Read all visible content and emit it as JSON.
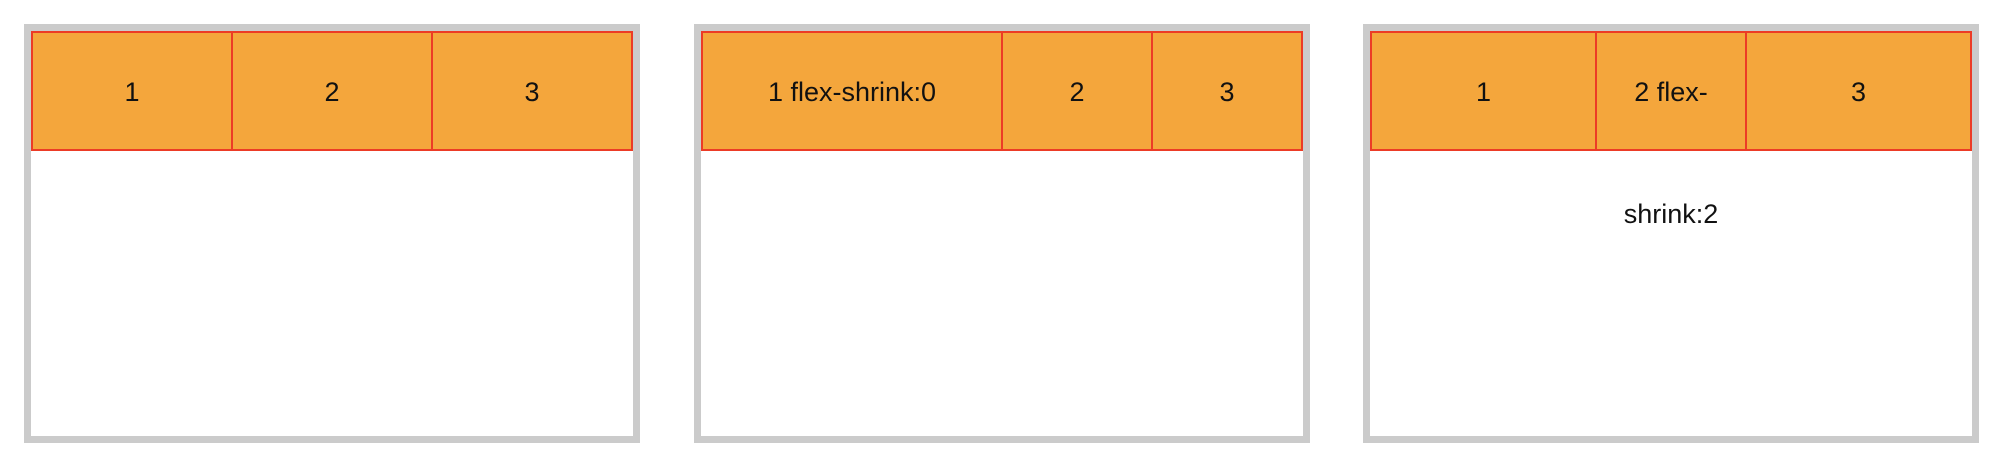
{
  "panels": [
    {
      "items": [
        {
          "label": "1"
        },
        {
          "label": "2"
        },
        {
          "label": "3"
        }
      ]
    },
    {
      "items": [
        {
          "label": "1 flex-shrink:0"
        },
        {
          "label": "2"
        },
        {
          "label": "3"
        }
      ]
    },
    {
      "items": [
        {
          "label": "1"
        },
        {
          "label": "2 flex-",
          "label_line2": "shrink:2"
        },
        {
          "label": "3"
        }
      ]
    }
  ],
  "colors": {
    "item_fill": "#f4a63c",
    "item_border": "#ec3b26",
    "container_border": "#cbcbcb"
  }
}
